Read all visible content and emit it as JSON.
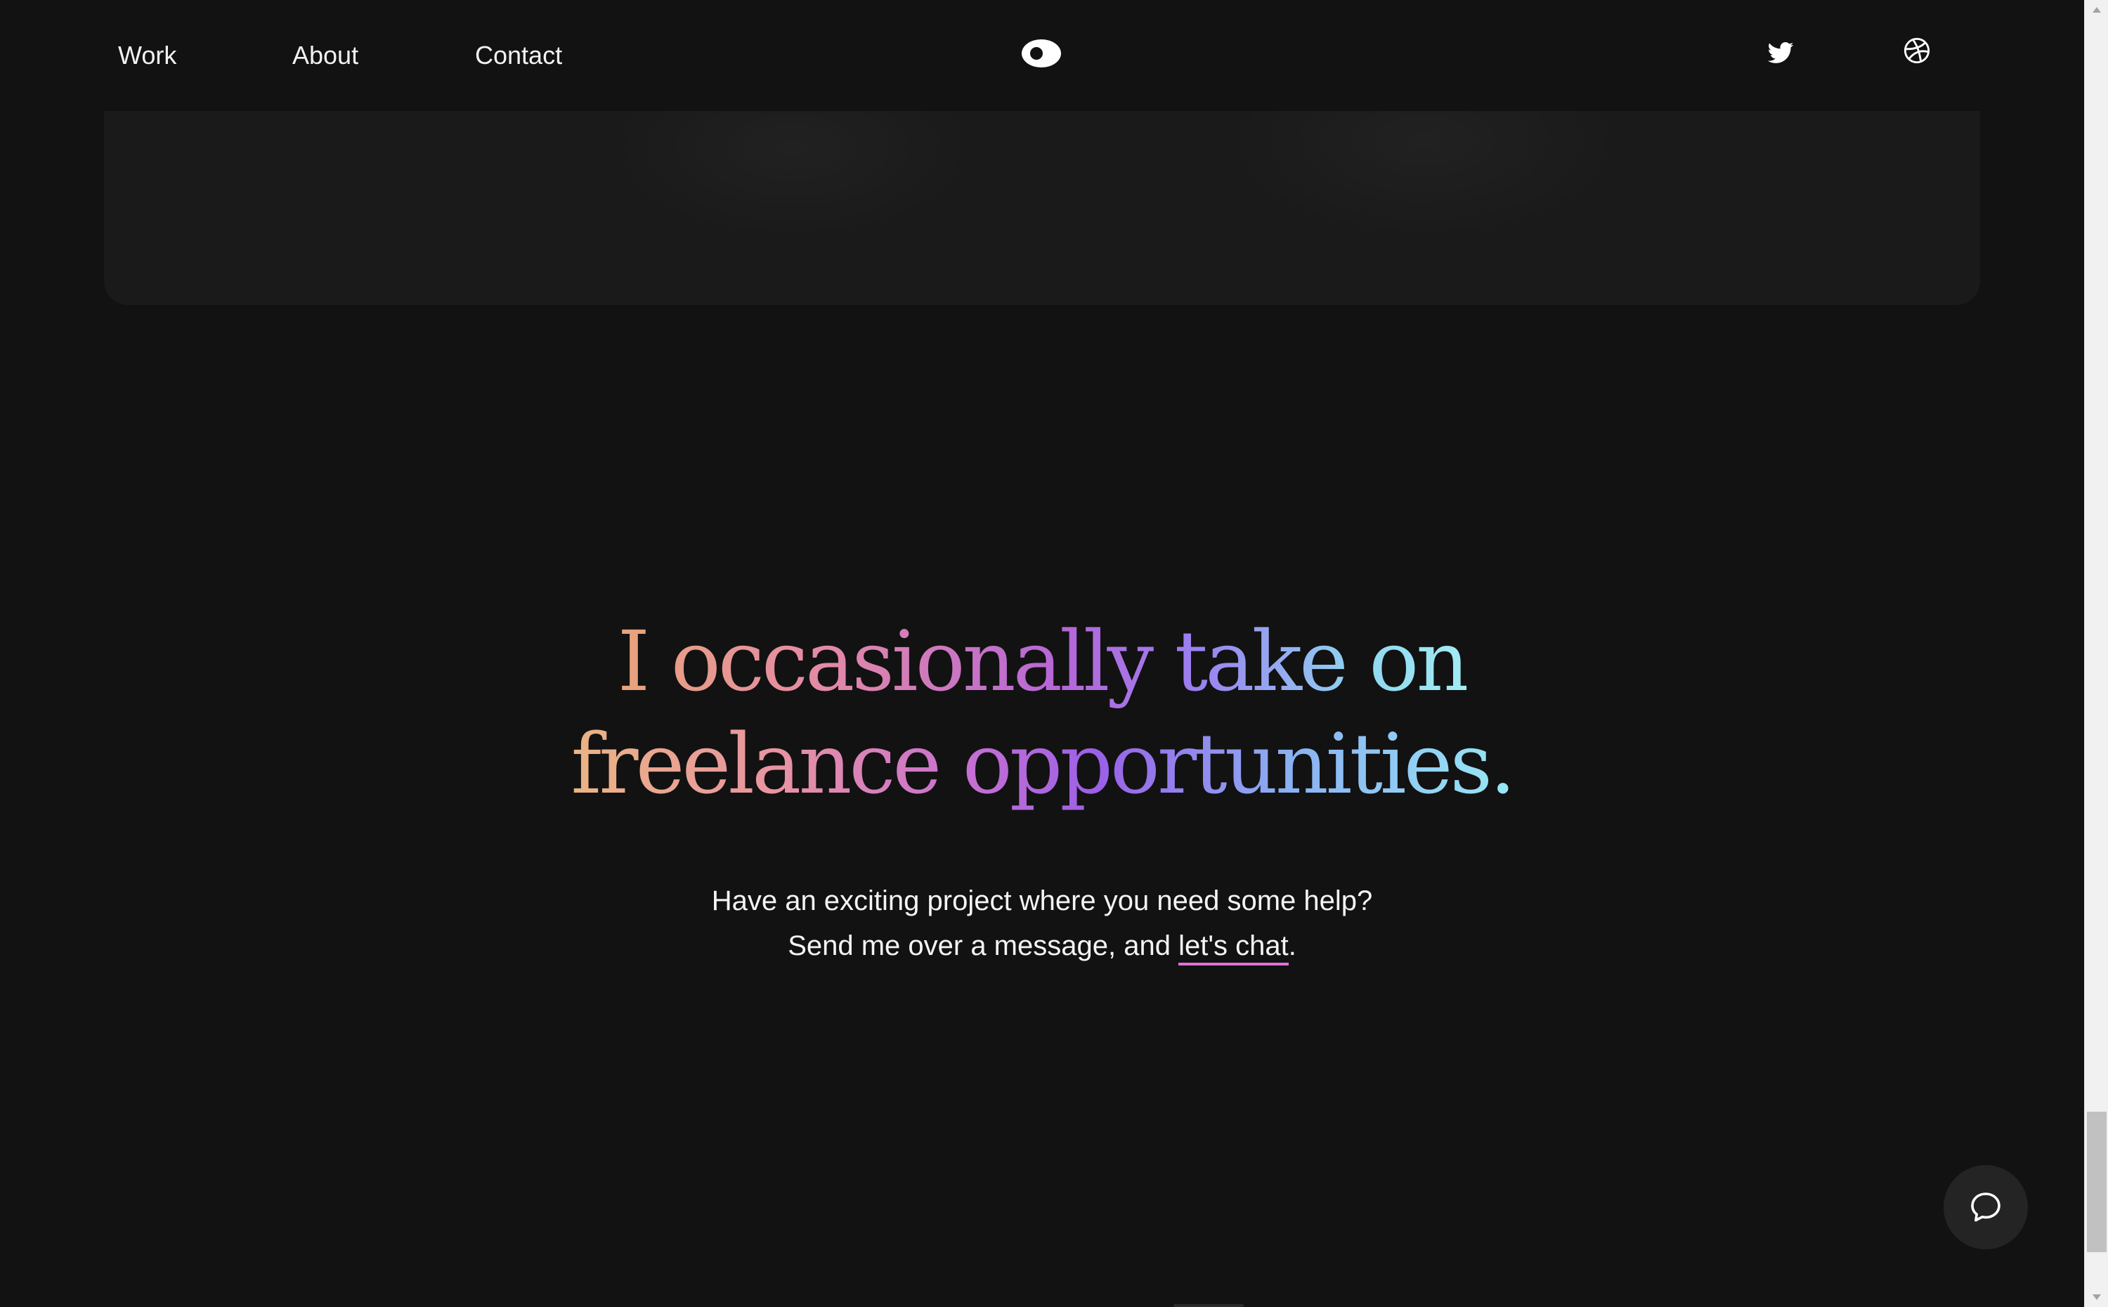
{
  "nav": {
    "links": [
      {
        "label": "Work"
      },
      {
        "label": "About"
      },
      {
        "label": "Contact"
      }
    ],
    "logo_icon": "eye-logo-icon",
    "social": [
      {
        "icon": "twitter-icon"
      },
      {
        "icon": "dribbble-icon"
      }
    ]
  },
  "hero": {
    "line1": "I occasionally take on",
    "line2": "freelance opportunities.",
    "gradient_colors": [
      "#e9a47c",
      "#e48aa6",
      "#b666d8",
      "#9b7ff0",
      "#8fd8f0"
    ]
  },
  "subtext": {
    "line1": "Have an exciting project where you need some help?",
    "line2_before": "Send me over a message, and ",
    "link_label": "let's chat",
    "line2_after": ".",
    "link_underline_color": "#e26fd8"
  },
  "chat_widget": {
    "icon": "chat-bubble-icon"
  },
  "scrollbar": {
    "position_fraction": 0.97
  },
  "colors": {
    "background": "#121212",
    "card": "#1a1a1a",
    "text": "#f2f2f2"
  }
}
